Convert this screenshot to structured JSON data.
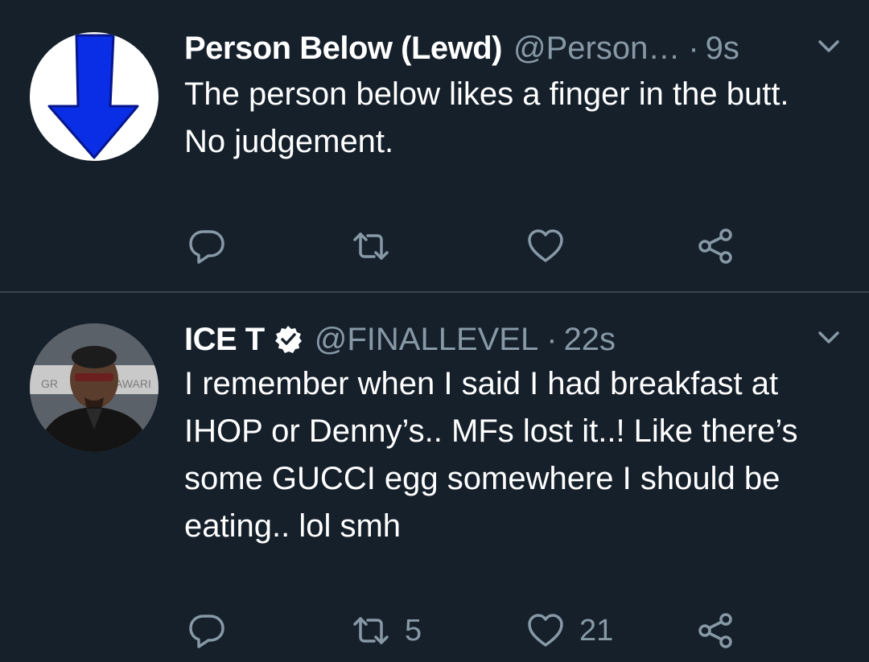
{
  "tweets": [
    {
      "name": "Person Below (Lewd)",
      "handle": "@Person…",
      "dot": "·",
      "time": "9s",
      "text": "The person below likes a finger in the butt. No judgement.",
      "verified": false,
      "retweets": "",
      "likes": ""
    },
    {
      "name": "ICE T",
      "handle": "@FINALLEVEL",
      "dot": "·",
      "time": "22s",
      "text": "I remember when I said I had breakfast at IHOP or Denny’s.. MFs lost it..! Like there’s some GUCCI egg somewhere I should be eating.. lol smh",
      "verified": true,
      "retweets": "5",
      "likes": "21",
      "avatar_backdrop_text": [
        "GR",
        "AWARI"
      ]
    }
  ],
  "colors": {
    "background": "#15202b",
    "divider": "#38444d",
    "secondary_text": "#8899a6",
    "arrow_blue": "#0a2de6"
  },
  "icons": [
    "arrow-down-icon",
    "verified-badge-icon",
    "chevron-down-icon",
    "reply-icon",
    "retweet-icon",
    "like-icon",
    "share-icon"
  ]
}
